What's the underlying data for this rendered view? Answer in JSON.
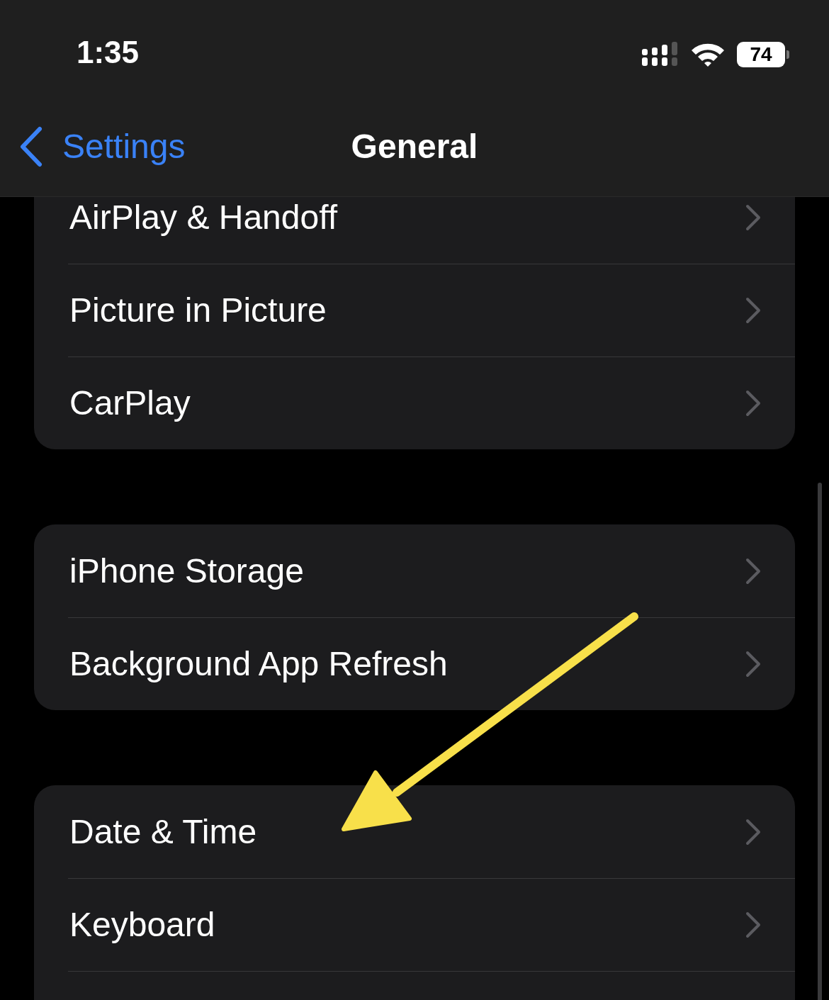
{
  "status_bar": {
    "time": "1:35",
    "battery": "74"
  },
  "nav": {
    "back": "Settings",
    "title": "General"
  },
  "groups": [
    {
      "items": [
        "AirPlay & Handoff",
        "Picture in Picture",
        "CarPlay"
      ]
    },
    {
      "items": [
        "iPhone Storage",
        "Background App Refresh"
      ]
    },
    {
      "items": [
        "Date & Time",
        "Keyboard"
      ]
    }
  ]
}
